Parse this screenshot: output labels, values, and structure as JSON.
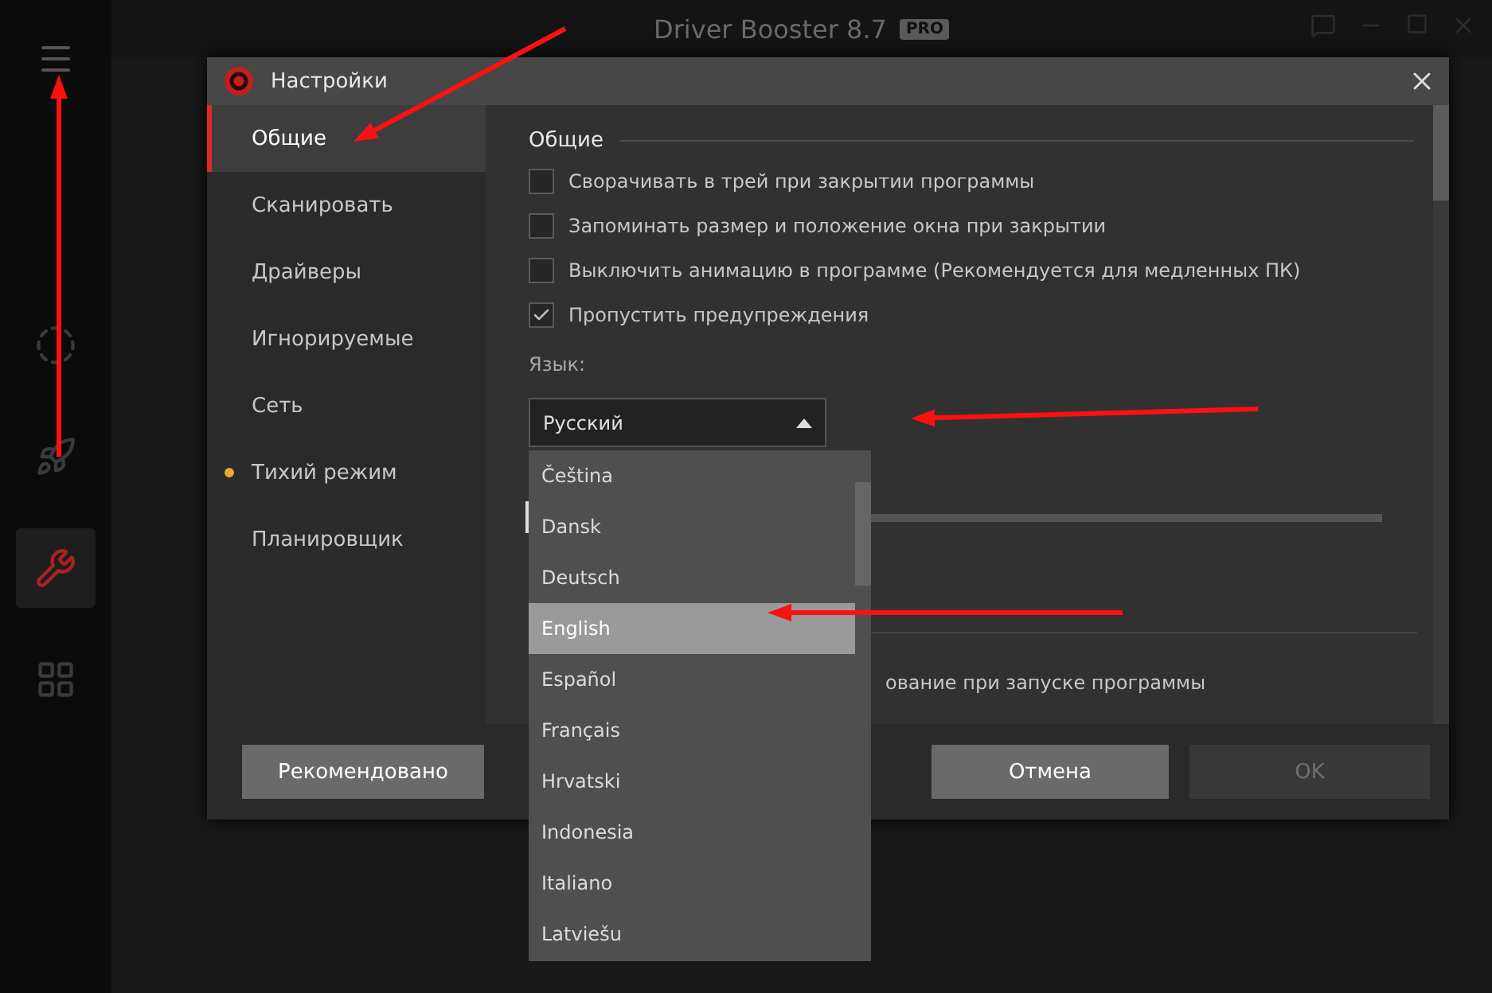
{
  "app": {
    "title": "Driver Booster 8.7",
    "badge": "PRO",
    "sidebar_items": [
      {
        "selected": false
      },
      {
        "selected": false
      },
      {
        "selected": true
      },
      {
        "selected": false
      }
    ]
  },
  "dialog": {
    "title": "Настройки",
    "nav": [
      {
        "label": "Общие",
        "selected": true,
        "dot": false
      },
      {
        "label": "Сканировать",
        "selected": false,
        "dot": false
      },
      {
        "label": "Драйверы",
        "selected": false,
        "dot": false
      },
      {
        "label": "Игнорируемые",
        "selected": false,
        "dot": false
      },
      {
        "label": "Сеть",
        "selected": false,
        "dot": false
      },
      {
        "label": "Тихий режим",
        "selected": false,
        "dot": true
      },
      {
        "label": "Планировщик",
        "selected": false,
        "dot": false
      }
    ],
    "section": "Общие",
    "options": [
      {
        "label": "Сворачивать в трей при закрытии программы",
        "checked": false
      },
      {
        "label": "Запоминать размер и положение окна при закрытии",
        "checked": false
      },
      {
        "label": "Выключить анимацию в программе (Рекомендуется для медленных ПК)",
        "checked": false
      },
      {
        "label": "Пропустить предупреждения",
        "checked": true
      }
    ],
    "language_label": "Язык:",
    "language": {
      "value": "Русский",
      "expanded": true,
      "options": [
        {
          "label": "Čeština",
          "selected": false
        },
        {
          "label": "Dansk",
          "selected": false
        },
        {
          "label": "Deutsch",
          "selected": false
        },
        {
          "label": "English",
          "selected": true
        },
        {
          "label": "Español",
          "selected": false
        },
        {
          "label": "Français",
          "selected": false
        },
        {
          "label": "Hrvatski",
          "selected": false
        },
        {
          "label": "Indonesia",
          "selected": false
        },
        {
          "label": "Italiano",
          "selected": false
        },
        {
          "label": "Latviešu",
          "selected": false
        }
      ]
    },
    "slider": {
      "level": 0
    },
    "partial_option": {
      "label": "ование при запуске программы"
    },
    "buttons": [
      {
        "label": "Рекомендовано",
        "disabled": false
      },
      {
        "label": "Отмена",
        "disabled": false
      },
      {
        "label": "OK",
        "disabled": true
      }
    ]
  }
}
